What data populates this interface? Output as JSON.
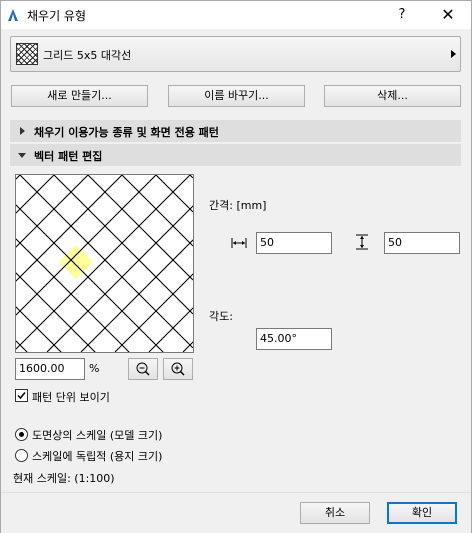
{
  "window": {
    "title": "채우기 유형",
    "help": "?",
    "close": "✕"
  },
  "fill_selector": {
    "value": "그리드 5x5 대각선"
  },
  "buttons": {
    "new": "새로 만들기...",
    "rename": "이름 바꾸기...",
    "delete": "삭제..."
  },
  "sections": {
    "availability": "채우기 이용가능 종류 및 화면 전용 패턴",
    "vector_edit": "벡터 패턴 편집"
  },
  "editor": {
    "spacing_label": "간격: [mm]",
    "spacing_x": "50",
    "spacing_y": "50",
    "angle_label": "각도:",
    "angle": "45.00°",
    "zoom": "1600.00",
    "zoom_unit": "%",
    "show_pattern_unit": "패턴 단위 보이기",
    "show_pattern_unit_checked": true
  },
  "scale": {
    "option_model": "도면상의 스케일 (모델 크기)",
    "option_paper": "스케일에 독립적 (용지 크기)",
    "selected": "model",
    "current_scale": "현재 스케일: (1:100)"
  },
  "footer": {
    "cancel": "취소",
    "ok": "확인"
  },
  "colors": {
    "highlight_cell": "#ffff99",
    "accent_border": "#0078d7",
    "section_bg": "#dedede"
  }
}
